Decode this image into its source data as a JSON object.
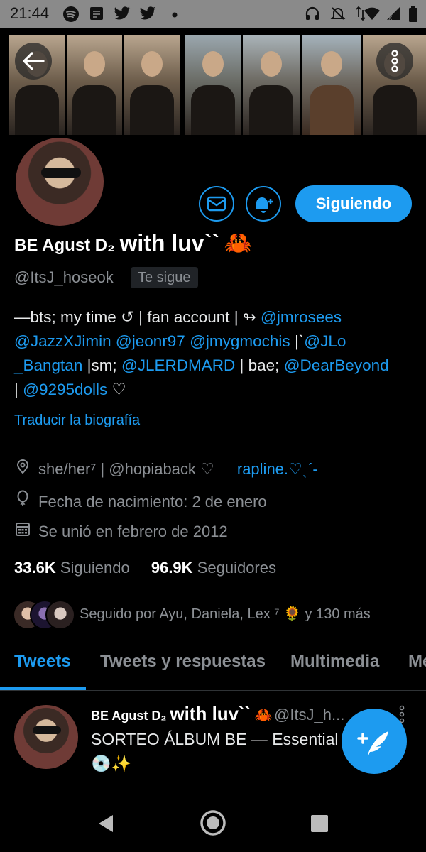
{
  "status_bar": {
    "time": "21:44"
  },
  "profile": {
    "display_name_prefix": "BE  Agust D₂",
    "display_name_main": "with luv``",
    "display_name_emoji": "🦀",
    "handle": "@ItsJ_hoseok",
    "follows_you_badge": "Te sigue",
    "follow_button": "Siguiendo",
    "bio": {
      "line1_text": "—bts; my time ↺ | fan account | ↬ ",
      "line1_link": "@jmrosees",
      "line2_link1": "@JazzXJimin",
      "line2_link2": "@jeonr97",
      "line2_link3": "@jmygmochis",
      "line2_sep": " |`",
      "line2_link4": "@JLo",
      "line3_link4_cont": "_Bangtan",
      "line3_text1": " |sm; ",
      "line3_link5": "@JLERDMARD",
      "line3_text2": " | bae; ",
      "line3_link6": "@DearBeyond",
      "line4_text1": "| ",
      "line4_link7": "@9295dolls",
      "line4_text2": " ♡"
    },
    "translate_link": "Traducir la biografía",
    "location": "she/her⁷ | @hopiaback ♡",
    "website": "rapline.♡ˎˊ-",
    "birthday": "Fecha de nacimiento: 2 de enero",
    "joined": "Se unió en febrero de 2012",
    "following_count": "33.6K",
    "following_label": "Siguiendo",
    "followers_count": "96.9K",
    "followers_label": "Seguidores",
    "followed_by": "Seguido por Ayu, Daniela, Lex ⁷ 🌻 y 130 más"
  },
  "tabs": [
    "Tweets",
    "Tweets y respuestas",
    "Multimedia",
    "Me"
  ],
  "tweet": {
    "name_prefix": "BE  Agust D₂",
    "name_main": "with luv``",
    "name_emoji": "🦀",
    "handle": "@ItsJ_h...",
    "text_line1": "SORTEO ÁLBUM BE — Essential",
    "text_line2": "💿✨"
  },
  "colors": {
    "accent": "#1d9bf0",
    "background": "#000000",
    "muted": "#8b8f94"
  },
  "icons": [
    "back-arrow-icon",
    "more-vertical-icon",
    "mail-icon",
    "bell-plus-icon",
    "location-icon",
    "balloon-icon",
    "calendar-icon",
    "compose-tweet-icon",
    "nav-back-icon",
    "nav-home-icon",
    "nav-recents-icon"
  ]
}
